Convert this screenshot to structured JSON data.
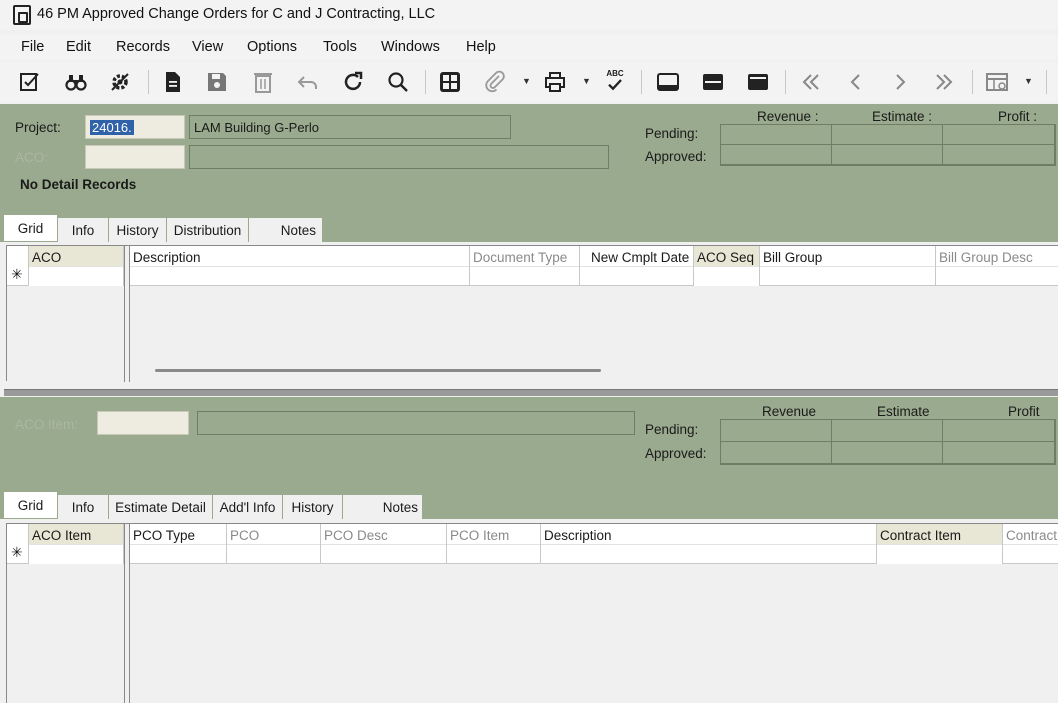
{
  "window": {
    "title": "46 PM Approved Change Orders for C and J Contracting, LLC",
    "icon": "app-document-icon"
  },
  "menu": [
    "File",
    "Edit",
    "Records",
    "View",
    "Options",
    "Tools",
    "Windows",
    "Help"
  ],
  "toolbar": {
    "icons": [
      "edit-form-icon",
      "binoculars-find-icon",
      "settings-gear-icon",
      "new-document-icon",
      "save-icon",
      "delete-icon",
      "undo-icon",
      "refresh-icon",
      "search-icon",
      "calculator-icon",
      "attachment-icon",
      "print-icon",
      "spellcheck-icon",
      "layout-single-icon",
      "layout-split-icon",
      "layout-tabbed-icon",
      "first-record-icon",
      "previous-record-icon",
      "next-record-icon",
      "last-record-icon",
      "grid-options-icon"
    ],
    "spellcheck_text": "ABC"
  },
  "header": {
    "project_label": "Project:",
    "project_value": "24016.",
    "project_desc": "LAM Building G-Perlo",
    "aco_label": "ACO:",
    "aco_value": "",
    "aco_desc": "",
    "no_detail": "No Detail Records",
    "summary": {
      "revenue": "Revenue  :",
      "estimate": "Estimate  :",
      "profit": "Profit  :",
      "pending": "Pending:",
      "approved": "Approved:"
    }
  },
  "top_tabs": [
    "Grid",
    "Info",
    "History",
    "Distribution",
    "Notes"
  ],
  "top_grid": {
    "columns": [
      "ACO",
      "Description",
      "Document Type",
      "New Cmplt Date",
      "ACO Seq",
      "Bill Group",
      "Bill Group Desc"
    ],
    "new_row_marker": "✳"
  },
  "item_header": {
    "aco_item_label": "ACO Item:",
    "summary": {
      "revenue": "Revenue",
      "estimate": "Estimate",
      "profit": "Profit",
      "pending": "Pending:",
      "approved": "Approved:"
    }
  },
  "bottom_tabs": [
    "Grid",
    "Info",
    "Estimate Detail",
    "Add'l Info",
    "History",
    "Notes"
  ],
  "bottom_grid": {
    "columns": [
      "ACO Item",
      "PCO Type",
      "PCO",
      "PCO Desc",
      "PCO Item",
      "Description",
      "Contract Item",
      "Contract"
    ],
    "new_row_marker": "✳"
  },
  "colors": {
    "panel": "#9aaa8e",
    "selection": "#2f62a8",
    "key_column": "#e8e6d4"
  }
}
